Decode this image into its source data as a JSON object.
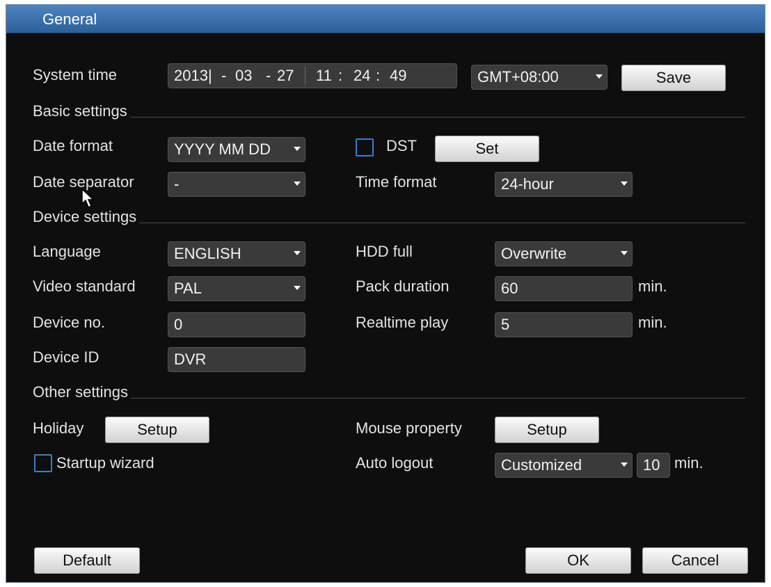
{
  "window": {
    "title": "General"
  },
  "system_time": {
    "label": "System time",
    "year": "2013|",
    "sep1": "-",
    "month": "03",
    "sep2": "-",
    "day": "27",
    "hour": "11",
    "colon1": ":",
    "minute": "24",
    "colon2": ":",
    "second": "49",
    "timezone": "GMT+08:00",
    "save_label": "Save"
  },
  "basic_settings": {
    "heading": "Basic settings",
    "date_format": {
      "label": "Date format",
      "value": "YYYY MM DD"
    },
    "dst": {
      "label": "DST",
      "checked": false,
      "set_label": "Set"
    },
    "date_separator": {
      "label": "Date separator",
      "value": "-"
    },
    "time_format": {
      "label": "Time format",
      "value": "24-hour"
    }
  },
  "device_settings": {
    "heading": "Device settings",
    "language": {
      "label": "Language",
      "value": "ENGLISH"
    },
    "hdd_full": {
      "label": "HDD full",
      "value": "Overwrite"
    },
    "video_standard": {
      "label": "Video standard",
      "value": "PAL"
    },
    "pack_duration": {
      "label": "Pack duration",
      "value": "60",
      "unit": "min."
    },
    "device_no": {
      "label": "Device no.",
      "value": "0"
    },
    "realtime_play": {
      "label": "Realtime play",
      "value": "5",
      "unit": "min."
    },
    "device_id": {
      "label": "Device ID",
      "value": "DVR"
    }
  },
  "other_settings": {
    "heading": "Other settings",
    "holiday": {
      "label": "Holiday",
      "button_label": "Setup"
    },
    "mouse_property": {
      "label": "Mouse property",
      "button_label": "Setup"
    },
    "startup_wizard": {
      "label": "Startup wizard",
      "checked": false
    },
    "auto_logout": {
      "label": "Auto logout",
      "mode": "Customized",
      "value": "10",
      "unit": "min."
    }
  },
  "footer": {
    "default_label": "Default",
    "ok_label": "OK",
    "cancel_label": "Cancel"
  },
  "colors": {
    "titlebar": "#3a6ea8",
    "background": "#0e0e0e",
    "field": "#3a3a3a",
    "checkbox_border": "#3e7cc9"
  }
}
